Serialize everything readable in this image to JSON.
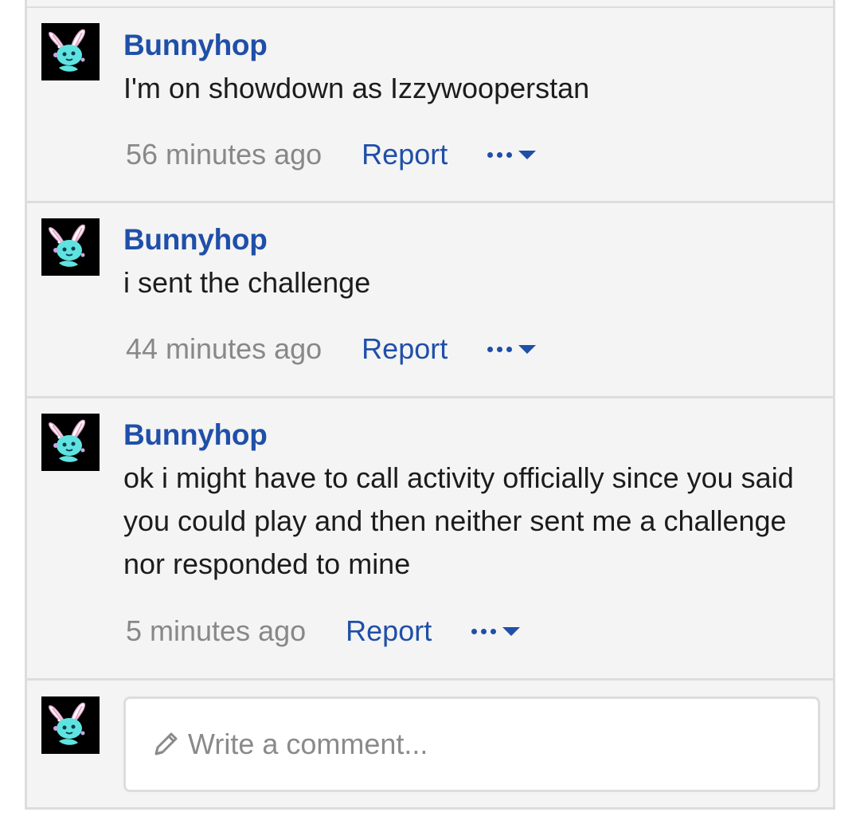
{
  "comments": [
    {
      "author": "Bunnyhop",
      "text": "I'm on showdown as Izzywooperstan",
      "time": "56 minutes ago",
      "report_label": "Report"
    },
    {
      "author": "Bunnyhop",
      "text": "i sent the challenge",
      "time": "44 minutes ago",
      "report_label": "Report"
    },
    {
      "author": "Bunnyhop",
      "text": "ok i might have to call activity officially since you said you could play and then neither sent me a challenge nor responded to mine",
      "time": "5 minutes ago",
      "report_label": "Report"
    }
  ],
  "composer": {
    "placeholder": "Write a comment..."
  },
  "icons": {
    "more": "more-options-icon",
    "caret": "caret-down-icon",
    "pencil": "pencil-icon",
    "avatar": "bunny-avatar"
  },
  "colors": {
    "link": "#1f4fa8",
    "meta": "#888888",
    "background": "#f4f4f4",
    "border": "#dddddd"
  }
}
